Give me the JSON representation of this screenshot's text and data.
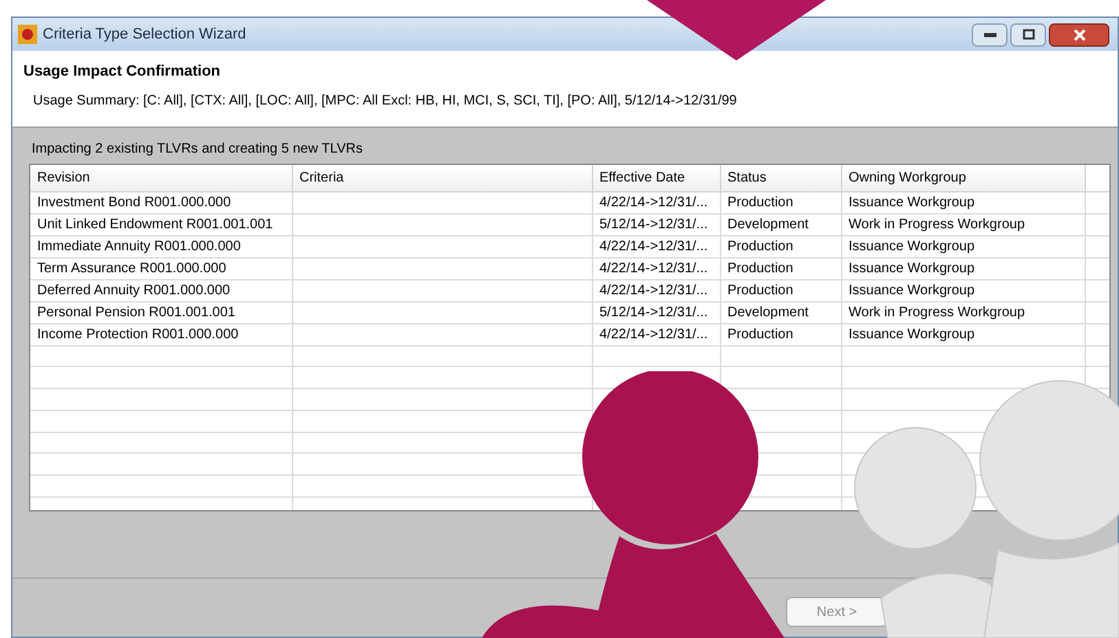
{
  "window": {
    "title": "Criteria Type Selection Wizard"
  },
  "header": {
    "title": "Usage Impact Confirmation",
    "summary": "Usage Summary: [C: All], [CTX: All], [LOC: All], [MPC: All Excl: HB, HI, MCI, S, SCI, TI], [PO: All], 5/12/14->12/31/99"
  },
  "message": "Impacting 2 existing TLVRs and creating 5 new TLVRs",
  "table": {
    "columns": [
      "Revision",
      "Criteria",
      "Effective Date",
      "Status",
      "Owning Workgroup"
    ],
    "rows": [
      [
        "Investment Bond R001.000.000",
        "",
        "4/22/14->12/31/...",
        "Production",
        "Issuance Workgroup"
      ],
      [
        "Unit Linked Endowment R001.001.001",
        "",
        "5/12/14->12/31/...",
        "Development",
        "Work in Progress Workgroup"
      ],
      [
        "Immediate Annuity R001.000.000",
        "",
        "4/22/14->12/31/...",
        "Production",
        "Issuance Workgroup"
      ],
      [
        "Term Assurance R001.000.000",
        "",
        "4/22/14->12/31/...",
        "Production",
        "Issuance Workgroup"
      ],
      [
        "Deferred Annuity R001.000.000",
        "",
        "4/22/14->12/31/...",
        "Production",
        "Issuance Workgroup"
      ],
      [
        "Personal Pension R001.001.001",
        "",
        "5/12/14->12/31/...",
        "Development",
        "Work in Progress Workgroup"
      ],
      [
        "Income Protection R001.000.000",
        "",
        "4/22/14->12/31/...",
        "Production",
        "Issuance Workgroup"
      ]
    ]
  },
  "buttons": [
    {
      "label": "Next >",
      "disabled": true
    }
  ]
}
